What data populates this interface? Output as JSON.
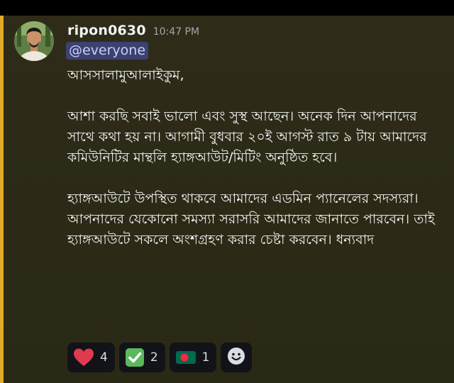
{
  "message": {
    "username": "ripon0630",
    "timestamp": "10:47 PM",
    "mention": "@everyone",
    "paragraphs": [
      "আসসালামুআলাইকুম,",
      "আশা করছি সবাই ভালো এবং সুস্থ আছেন। অনেক দিন আপনাদের সাথে কথা হয় না। আগামী বুধবার ২০ই আগস্ট  রাত ৯ টায় আমাদের কমিউনিটির মান্থলি হ্যাঙ্গআউট/মিটিং অনুষ্ঠিত হবে।",
      "হ্যাঙ্গআউটে উপস্থিত থাকবে আমাদের এডমিন প্যানেলের সদস্যরা। আপনাদের যেকোনো সমস্যা সরাসরি আমাদের জানাতে পারবেন। তাই হ্যাঙ্গআউটে সকলে অংশগ্রহণ করার চেষ্টা করবেন।  ধন্যবাদ"
    ]
  },
  "reactions": [
    {
      "icon": "heart-icon",
      "count": "4"
    },
    {
      "icon": "check-mark-icon",
      "count": "2"
    },
    {
      "icon": "bangladesh-flag-icon",
      "count": "1"
    }
  ],
  "colors": {
    "mention_bar": "#e3a92b",
    "mention_bg": "#3c4270",
    "heart": "#e03a4f",
    "check_bg": "#5cb85c",
    "flag_green": "#006a4e",
    "flag_red": "#f42a41"
  }
}
